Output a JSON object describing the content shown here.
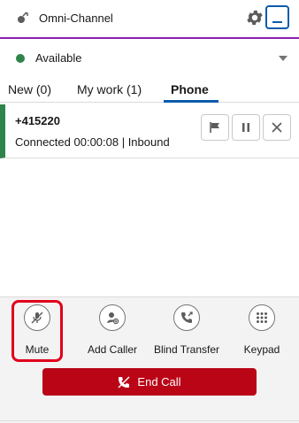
{
  "header": {
    "title": "Omni-Channel",
    "icons": [
      "omni-channel-icon",
      "gear-icon",
      "minimize-icon"
    ]
  },
  "status": {
    "label": "Available",
    "color": "#2e844a"
  },
  "tabs": [
    {
      "label": "New (0)"
    },
    {
      "label": "My work (1)"
    },
    {
      "label": "Phone",
      "selected": true
    }
  ],
  "work_item": {
    "number": "+415220",
    "status": "Connected 00:00:08 | Inbound",
    "controls": [
      "flag-icon",
      "pause-icon",
      "close-icon"
    ]
  },
  "actions": [
    {
      "label": "Mute",
      "icon": "mute-icon",
      "highlighted": true
    },
    {
      "label": "Add Caller",
      "icon": "add-caller-icon"
    },
    {
      "label": "Blind Transfer",
      "icon": "blind-transfer-icon"
    },
    {
      "label": "Keypad",
      "icon": "keypad-icon"
    }
  ],
  "end_call": {
    "label": "End Call",
    "color": "#ba0517"
  },
  "colors": {
    "accent": "#8a1fb3",
    "tab_underline": "#0b5cab",
    "highlight": "#e0001b"
  }
}
